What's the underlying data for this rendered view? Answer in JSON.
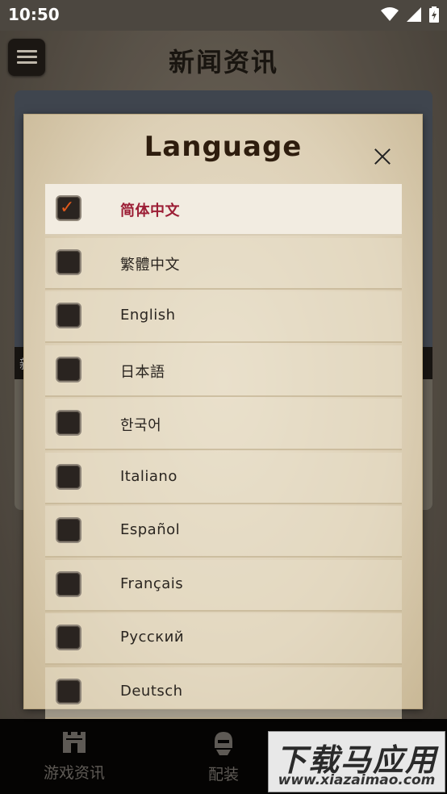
{
  "status_bar": {
    "time": "10:50"
  },
  "header": {
    "title": "新闻资讯"
  },
  "background": {
    "card_text": "新"
  },
  "dialog": {
    "title": "Language",
    "languages": [
      {
        "label": "简体中文",
        "checked": true
      },
      {
        "label": "繁體中文",
        "checked": false
      },
      {
        "label": "English",
        "checked": false
      },
      {
        "label": "日本語",
        "checked": false
      },
      {
        "label": "한국어",
        "checked": false
      },
      {
        "label": "Italiano",
        "checked": false
      },
      {
        "label": "Español",
        "checked": false
      },
      {
        "label": "Français",
        "checked": false
      },
      {
        "label": "Русский",
        "checked": false
      },
      {
        "label": "Deutsch",
        "checked": false
      }
    ]
  },
  "bottom_nav": {
    "items": [
      {
        "label": "游戏资讯",
        "icon": "castle-icon"
      },
      {
        "label": "配装",
        "icon": "helmet-icon"
      }
    ]
  },
  "watermark": {
    "main": "下载马应用",
    "url": "www.xiazaimao.com"
  },
  "colors": {
    "selected_text": "#9c1e35",
    "checkmark": "#e25a1c",
    "dialog_title": "#2e1d0e"
  }
}
